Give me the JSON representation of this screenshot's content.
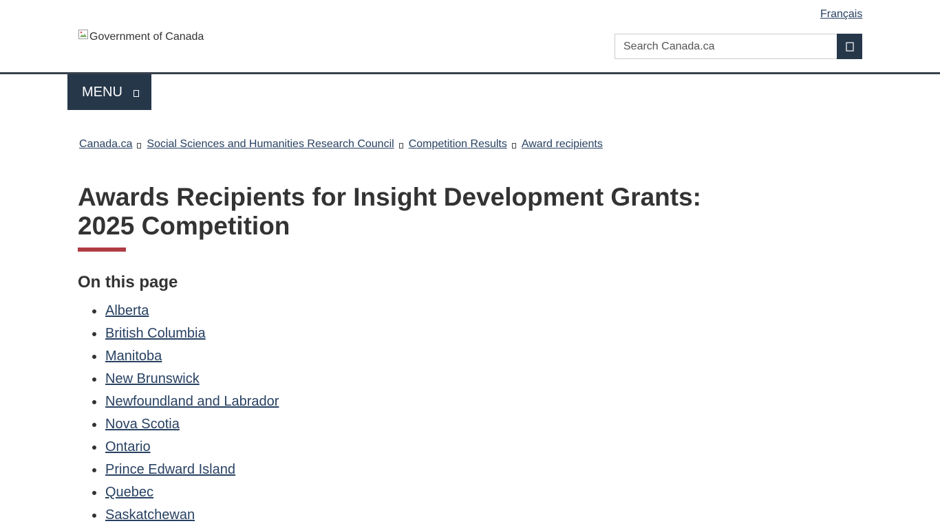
{
  "header": {
    "language_link": "Français",
    "logo_alt": "Government of Canada",
    "search": {
      "placeholder": "Search Canada.ca",
      "button_icon": "search-icon"
    },
    "menu_label": "MENU"
  },
  "breadcrumb": [
    "Canada.ca",
    "Social Sciences and Humanities Research Council",
    "Competition Results",
    "Award recipients"
  ],
  "main": {
    "title_line1": "Awards Recipients for Insight Development Grants:",
    "title_line2": "2025 Competition",
    "toc_heading": "On this page",
    "toc_items": [
      "Alberta",
      "British Columbia",
      "Manitoba",
      "New Brunswick",
      "Newfoundland and Labrador",
      "Nova Scotia",
      "Ontario",
      "Prince Edward Island",
      "Quebec",
      "Saskatchewan"
    ]
  },
  "colors": {
    "link": "#284162",
    "header_dark": "#26374a",
    "accent_red": "#af3c43",
    "text": "#333333"
  }
}
